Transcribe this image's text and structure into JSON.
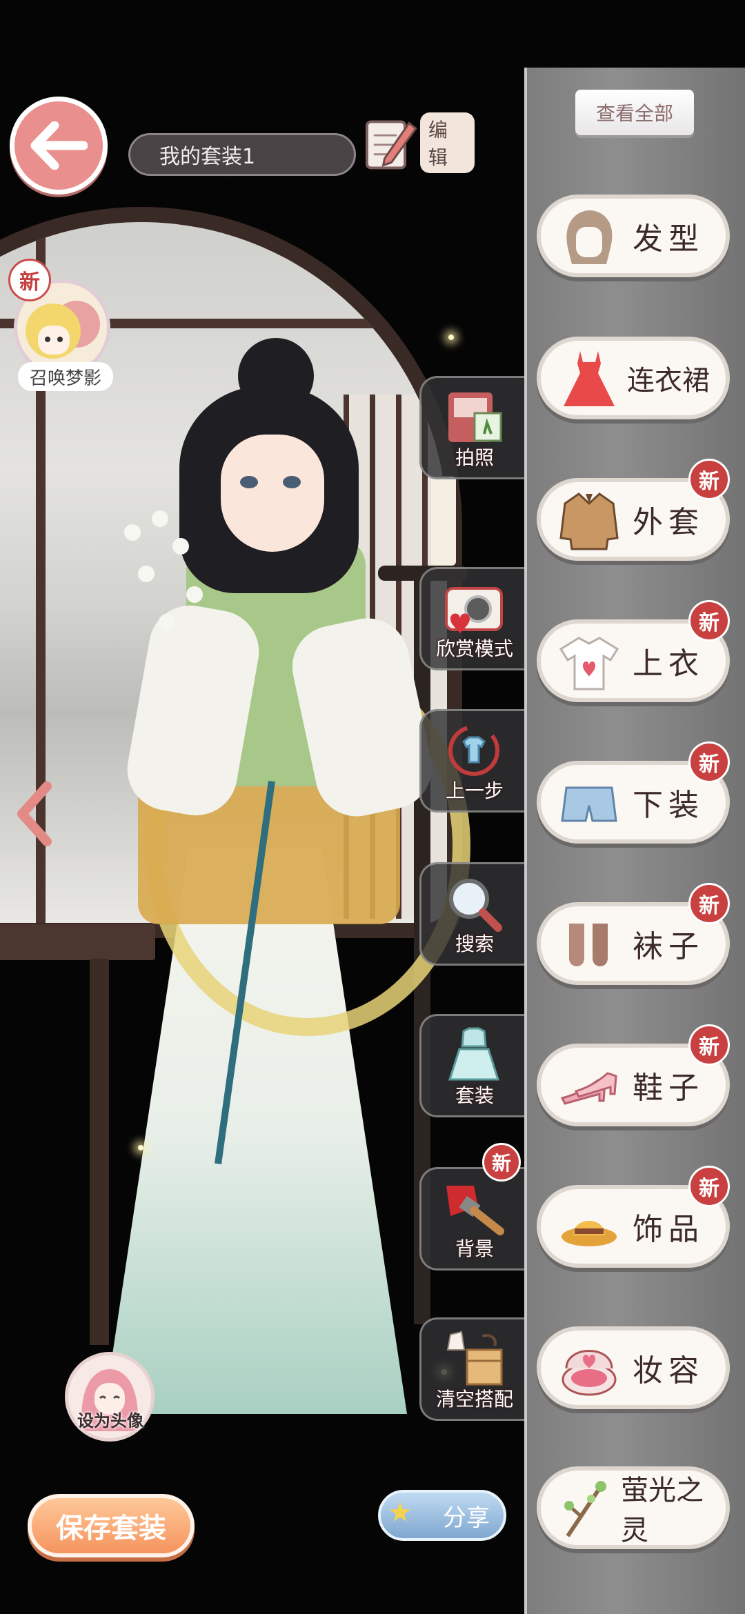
{
  "header": {
    "outfit_name": "我的套装1",
    "edit_label": "编辑"
  },
  "summon": {
    "new_badge": "新",
    "label": "召唤梦影"
  },
  "tools": [
    {
      "id": "photo",
      "label": "拍照",
      "icon": "notebook-icon",
      "new": ""
    },
    {
      "id": "view-mode",
      "label": "欣赏模式",
      "icon": "camera-heart-icon",
      "new": ""
    },
    {
      "id": "undo",
      "label": "上一步",
      "icon": "shirt-undo-icon",
      "new": ""
    },
    {
      "id": "search",
      "label": "搜索",
      "icon": "magnifier-icon",
      "new": ""
    },
    {
      "id": "suits",
      "label": "套装",
      "icon": "outfit-icon",
      "new": ""
    },
    {
      "id": "background",
      "label": "背景",
      "icon": "paint-brush-icon",
      "new": "新"
    },
    {
      "id": "clear",
      "label": "清空搭配",
      "icon": "box-icon",
      "new": ""
    }
  ],
  "panel": {
    "view_all": "查看全部",
    "categories": [
      {
        "id": "hair",
        "label": "发型",
        "icon": "hair-icon",
        "new": ""
      },
      {
        "id": "dress",
        "label": "连衣裙",
        "icon": "dress-icon",
        "new": ""
      },
      {
        "id": "coat",
        "label": "外套",
        "icon": "coat-icon",
        "new": "新"
      },
      {
        "id": "top",
        "label": "上衣",
        "icon": "tshirt-icon",
        "new": "新"
      },
      {
        "id": "bottom",
        "label": "下装",
        "icon": "shorts-icon",
        "new": "新"
      },
      {
        "id": "socks",
        "label": "袜子",
        "icon": "socks-icon",
        "new": "新"
      },
      {
        "id": "shoes",
        "label": "鞋子",
        "icon": "heels-icon",
        "new": "新"
      },
      {
        "id": "accessories",
        "label": "饰品",
        "icon": "hat-icon",
        "new": "新"
      },
      {
        "id": "makeup",
        "label": "妆容",
        "icon": "compact-icon",
        "new": ""
      },
      {
        "id": "spirit",
        "label": "萤光之灵",
        "icon": "branch-icon",
        "new": ""
      }
    ]
  },
  "bottom": {
    "avatar_label": "设为头像",
    "save_label": "保存套装",
    "share_label": "分享"
  },
  "colors": {
    "back_button": "#e98f8d",
    "save_button": "#f5945e",
    "new_badge": "#c8403f",
    "panel": "#8f8e8e"
  }
}
